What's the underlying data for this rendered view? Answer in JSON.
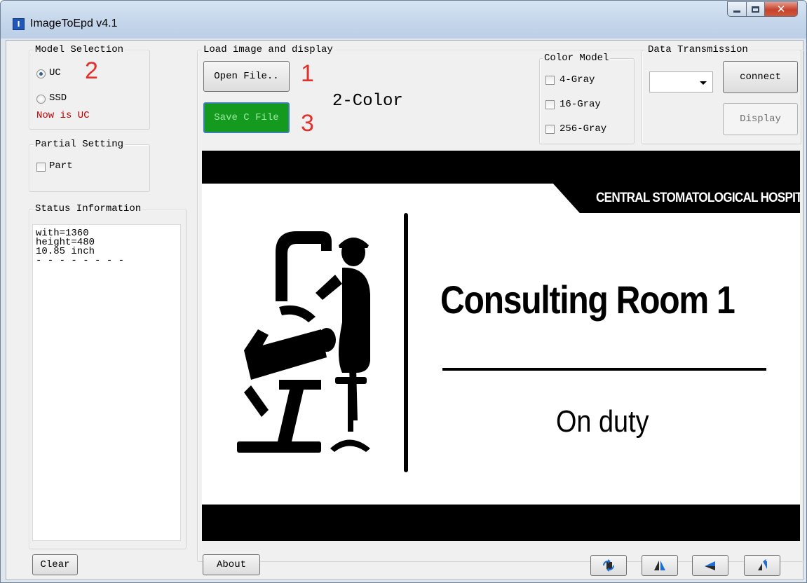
{
  "window": {
    "title": "ImageToEpd v4.1",
    "icon": "app-logo-icon"
  },
  "model_selection": {
    "title": "Model Selection",
    "options": [
      {
        "label": "UC",
        "selected": true
      },
      {
        "label": "SSD",
        "selected": false
      }
    ],
    "status": "Now is UC",
    "status_color": "#c00000"
  },
  "partial_setting": {
    "title": "Partial Setting",
    "checkbox_label": "Part",
    "checked": false
  },
  "status_info": {
    "title": "Status Information",
    "lines": [
      "with=1360",
      "height=480",
      "10.85 inch",
      "- - - - - - - -"
    ]
  },
  "buttons": {
    "clear": "Clear",
    "about": "About",
    "open_file": "Open File..",
    "save_c_file": "Save C File"
  },
  "load": {
    "title": "Load image and display",
    "color_mode": "2-Color"
  },
  "steps": {
    "open": "1",
    "model": "2",
    "save": "3"
  },
  "color_model": {
    "title": "Color Model",
    "options": [
      "4-Gray",
      "16-Gray",
      "256-Gray"
    ]
  },
  "data_transmission": {
    "title": "Data Transmission",
    "port_value": "",
    "connect": "connect",
    "display": "Display"
  },
  "preview": {
    "hospital": "CENTRAL STOMATOLOGICAL HOSPITAL",
    "room": "Consulting Room 1",
    "duty": "On duty"
  },
  "toolbar_icons": [
    "rotate-icon",
    "flip-horizontal-icon",
    "mirror-left-icon",
    "flip-vertical-icon"
  ],
  "colors": {
    "accent_green": "#139a1f",
    "step_red": "#e3302c"
  }
}
